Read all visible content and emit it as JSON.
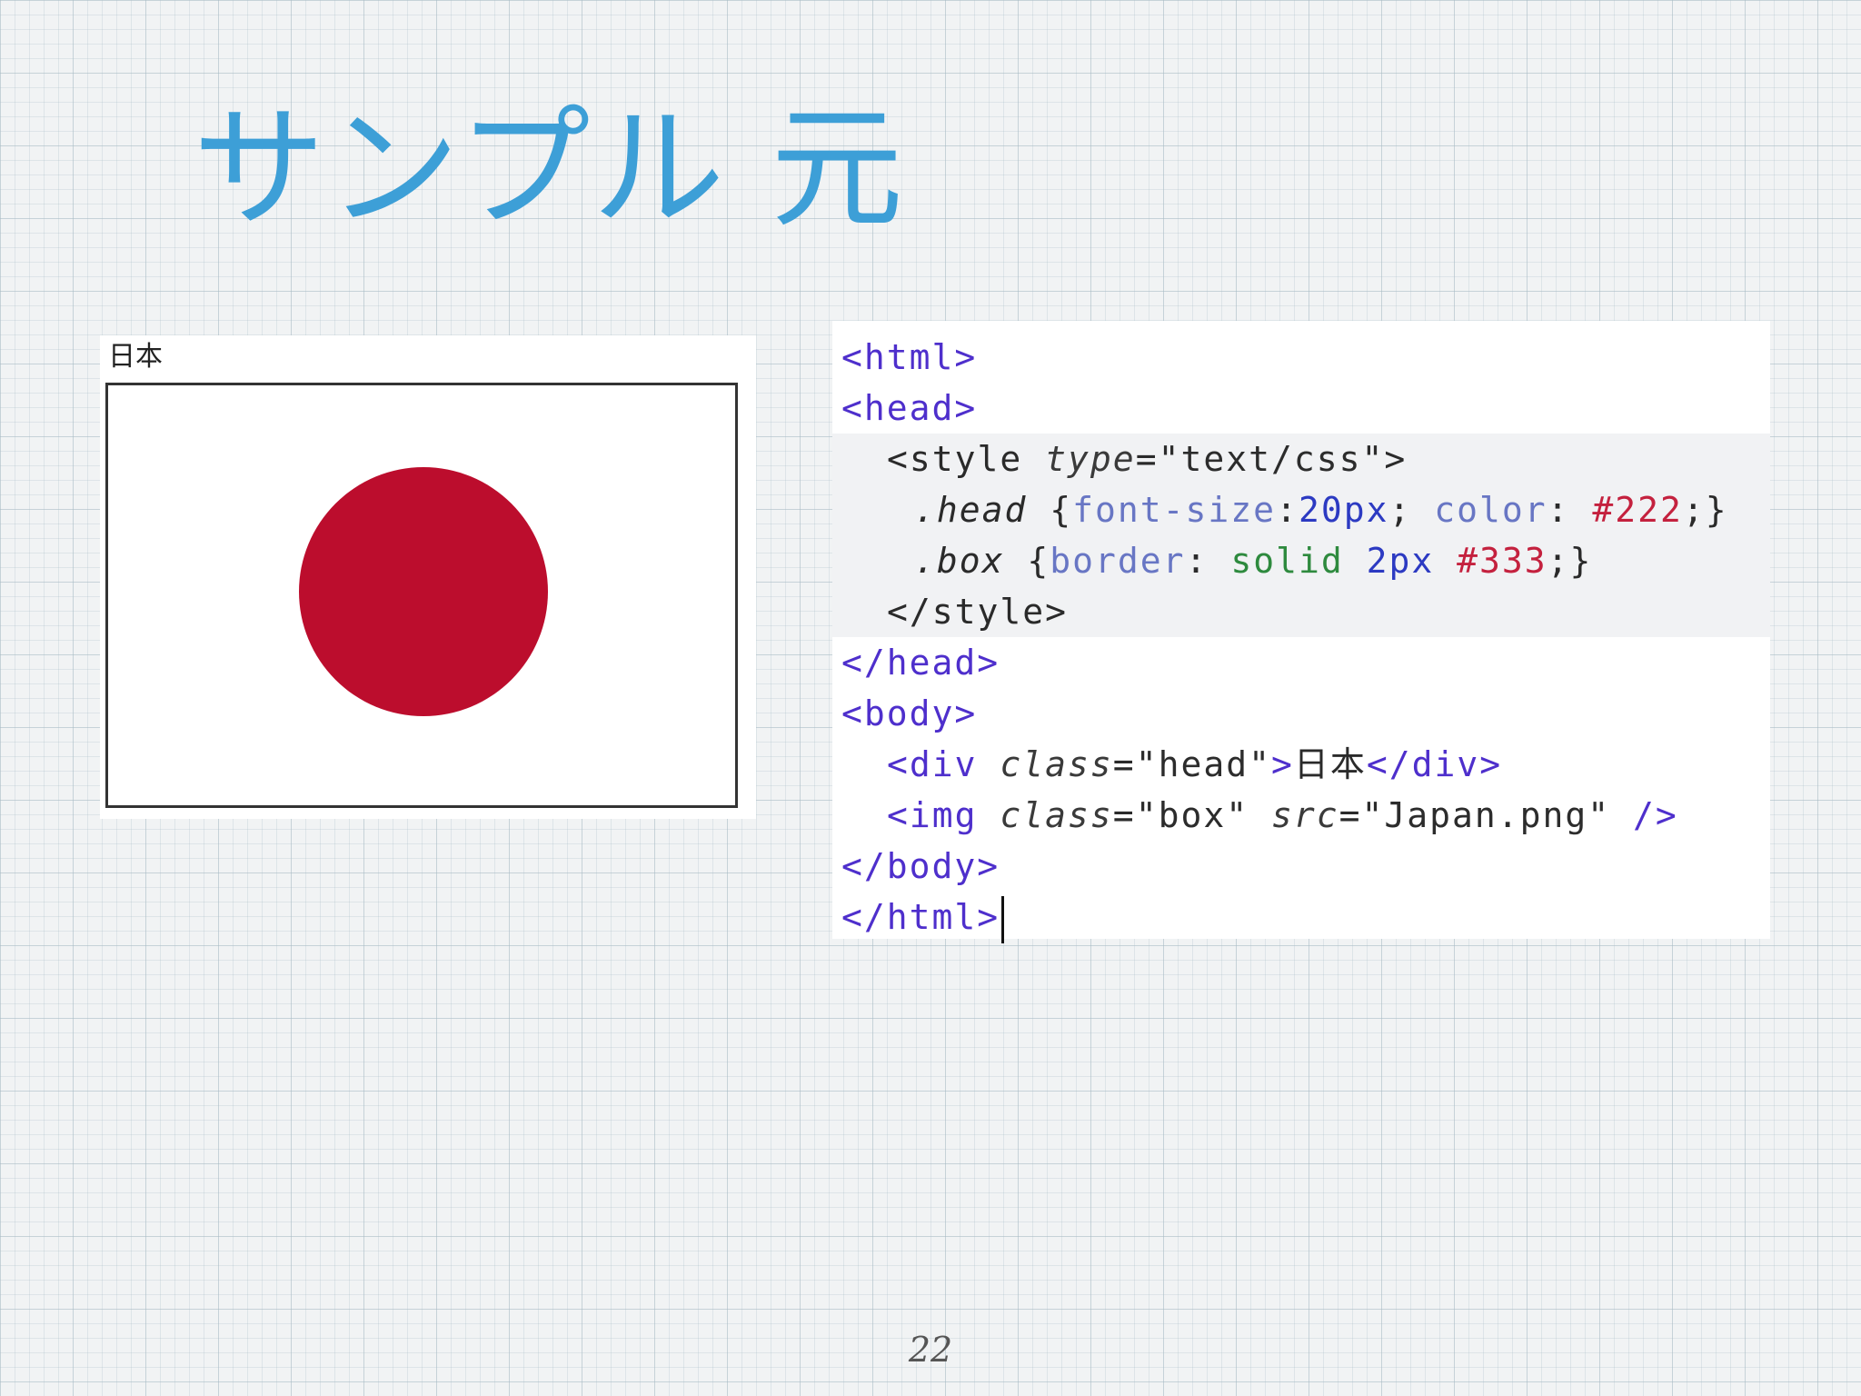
{
  "slide": {
    "title": "サンプル 元",
    "page_number": "22",
    "title_color": "#3d9fd7"
  },
  "preview": {
    "caption": "日本",
    "flag_disc_color": "#bc0d2d",
    "flag_border_color": "#333333"
  },
  "code": {
    "lines": {
      "l1": {
        "t1": "<html>"
      },
      "l2": {
        "t1": "<head>"
      },
      "l3": {
        "t1": "<style",
        "t2": " ",
        "t3": "type",
        "t4": "=",
        "t5": "\"text/css\"",
        "t6": ">"
      },
      "l4": {
        "t1": ".head",
        "t2": " {",
        "t3": "font-size",
        "t4": ":",
        "t5": "20px",
        "t6": "; ",
        "t7": "color",
        "t8": ": ",
        "t9": "#222",
        "t10": ";}"
      },
      "l5": {
        "t1": ".box",
        "t2": " {",
        "t3": "border",
        "t4": ": ",
        "t5": "solid",
        "t6": " ",
        "t7": "2px",
        "t8": " ",
        "t9": "#333",
        "t10": ";}"
      },
      "l6": {
        "t1": "</style>"
      },
      "l7": {
        "t1": "</head>"
      },
      "l8": {
        "t1": "<body>"
      },
      "l9": {
        "t1": "<div",
        "t2": " ",
        "t3": "class",
        "t4": "=",
        "t5": "\"head\"",
        "t6": ">",
        "t7": "日本",
        "t8": "</div>"
      },
      "l10": {
        "t1": "<img",
        "t2": " ",
        "t3": "class",
        "t4": "=",
        "t5": "\"box\"",
        "t6": " ",
        "t7": "src",
        "t8": "=",
        "t9": "\"Japan.png\"",
        "t10": " />"
      },
      "l11": {
        "t1": "</body>"
      },
      "l12": {
        "t1": "</html>"
      }
    }
  }
}
